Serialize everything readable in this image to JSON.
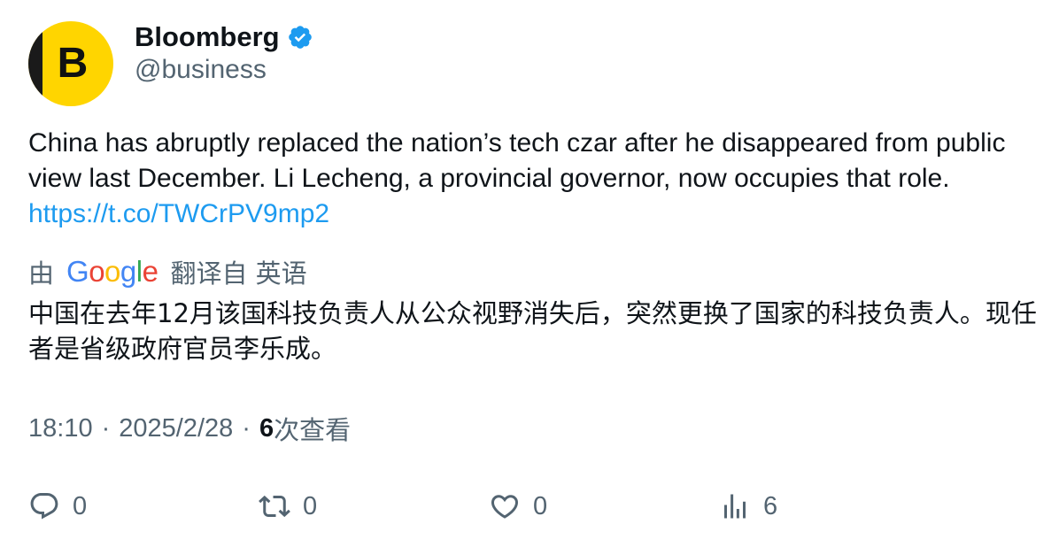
{
  "author": {
    "avatar_letter": "B",
    "display_name": "Bloomberg",
    "handle": "@business",
    "verified": true,
    "verified_color": "#1d9bf0",
    "avatar_color": "#ffd500"
  },
  "tweet": {
    "text": "China has abruptly replaced the nation’s tech czar after he disappeared from public view last December. Li Lecheng, a provincial governor, now occupies that role.",
    "link": "https://t.co/TWCrPV9mp2"
  },
  "translation": {
    "by_label": "由",
    "provider": "Google",
    "from_label": "翻译自 英语",
    "text": "中国在去年12月该国科技负责人从公众视野消失后，突然更换了国家的科技负责人。现任者是省级政府官员李乐成。"
  },
  "meta": {
    "time": "18:10",
    "separator": "·",
    "date": "2025/2/28",
    "views_count": "6",
    "views_label": "次查看"
  },
  "actions": {
    "replies": "0",
    "retweets": "0",
    "likes": "0",
    "views": "6"
  },
  "colors": {
    "text_primary": "#0f1419",
    "text_secondary": "#536471",
    "link": "#1d9bf0"
  }
}
